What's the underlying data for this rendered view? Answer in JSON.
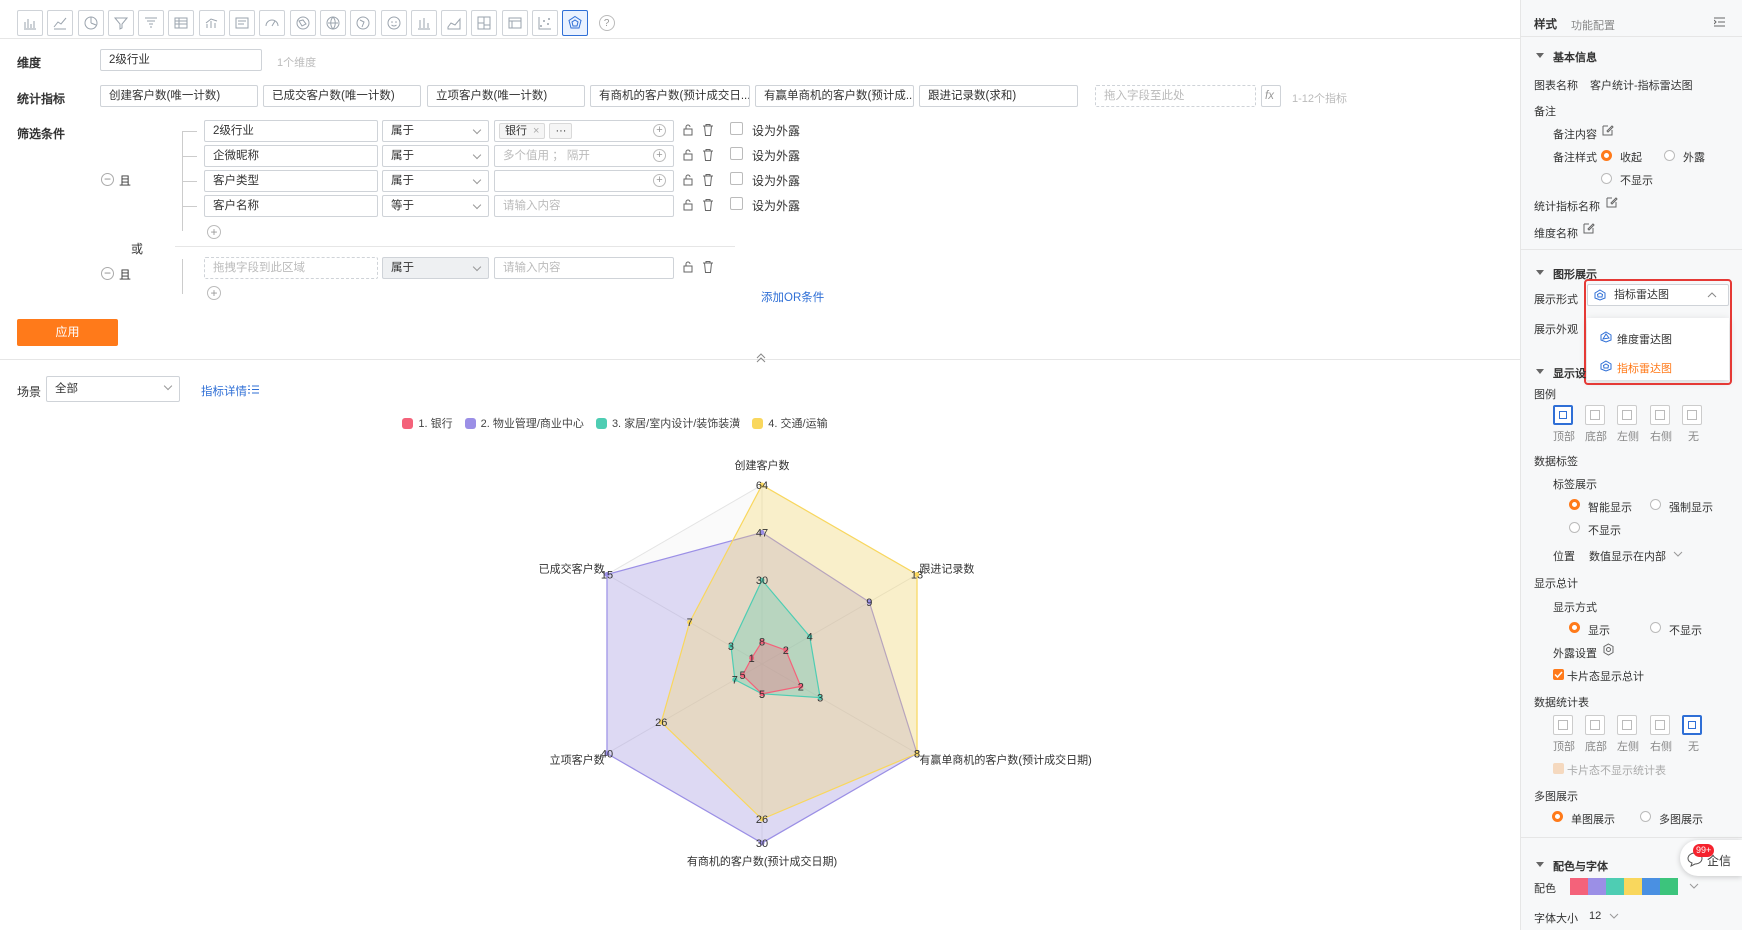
{
  "toolbar": {
    "icons": [
      "bar-chart-icon",
      "line-chart-icon",
      "pie-chart-icon",
      "funnel-icon",
      "funnel-alt-icon",
      "table-icon",
      "combo-chart-icon",
      "text-card-icon",
      "gauge-icon",
      "map-icon",
      "world-map-icon",
      "globe-icon",
      "smiley-chart-icon",
      "column-chart-icon",
      "area-chart-icon",
      "treemap-icon",
      "pivot-table-icon",
      "scatter-icon",
      "radar-chart-icon"
    ],
    "active_icon": "radar-chart-icon",
    "help": "?"
  },
  "filters": {
    "dimension_label": "维度",
    "dimension_value": "2级行业",
    "dimension_hint": "1个维度",
    "metrics_label": "统计指标",
    "metrics": [
      "创建客户数(唯一计数)",
      "已成交客户数(唯一计数)",
      "立项客户数(唯一计数)",
      "有商机的客户数(预计成交日...",
      "有赢单商机的客户数(预计成...",
      "跟进记录数(求和)"
    ],
    "metrics_drop_placeholder": "拖入字段至此处",
    "metrics_fx": "fx",
    "metrics_hint": "1-12个指标",
    "conditions_label": "筛选条件",
    "and_label": "且",
    "or_label": "或",
    "group1": [
      {
        "field": "2级行业",
        "op": "属于",
        "value_tag": "银行",
        "value_more": "···",
        "expose": "设为外露"
      },
      {
        "field": "企微昵称",
        "op": "属于",
        "value_placeholder": "多个值用 ； 隔开",
        "expose": "设为外露"
      },
      {
        "field": "客户类型",
        "op": "属于",
        "value_placeholder": "",
        "expose": "设为外露"
      },
      {
        "field": "客户名称",
        "op": "等于",
        "value_placeholder": "请输入内容",
        "expose": "设为外露"
      }
    ],
    "group2": {
      "field_placeholder": "拖拽字段到此区域",
      "op": "属于",
      "value_placeholder": "请输入内容"
    },
    "add_or": "添加OR条件",
    "apply": "应用"
  },
  "scene": {
    "label": "场景",
    "value": "全部",
    "detail_link": "指标详情"
  },
  "chart_data": {
    "type": "radar",
    "axes": [
      "创建客户数",
      "跟进记录数",
      "有赢单商机的客户数(预计成交日期)",
      "有商机的客户数(预计成交日期)",
      "立项客户数",
      "已成交客户数"
    ],
    "axis_max": [
      64,
      13,
      8,
      30,
      40,
      15
    ],
    "series": [
      {
        "name": "1. 银行",
        "color": "#f4627a",
        "values": [
          8,
          2,
          2,
          5,
          5,
          1
        ]
      },
      {
        "name": "2. 物业管理/商业中心",
        "color": "#9b8fe6",
        "values": [
          47,
          9,
          8,
          30,
          40,
          15
        ]
      },
      {
        "name": "3. 家居/室内设计/装饰装潢",
        "color": "#4ecdb3",
        "values": [
          30,
          4,
          3,
          5,
          7,
          3
        ]
      },
      {
        "name": "4. 交通/运输",
        "color": "#f9d75d",
        "values": [
          64,
          13,
          8,
          26,
          26,
          7
        ]
      }
    ]
  },
  "panel": {
    "tabs": [
      "样式",
      "功能配置"
    ],
    "basic_info": "基本信息",
    "chart_name_label": "图表名称",
    "chart_name": "客户统计-指标雷达图",
    "remark": "备注",
    "remark_content": "备注内容",
    "remark_style": "备注样式",
    "remark_opts": [
      "收起",
      "外露",
      "不显示"
    ],
    "metric_name": "统计指标名称",
    "dimension_name": "维度名称",
    "graph_display": "图形展示",
    "display_form": "展示形式",
    "display_form_value": "指标雷达图",
    "display_look": "展示外观",
    "dropdown_options": [
      "维度雷达图",
      "指标雷达图"
    ],
    "display_settings": "显示设",
    "legend": "图例",
    "legend_opts": [
      "顶部",
      "底部",
      "左侧",
      "右侧",
      "无"
    ],
    "data_label": "数据标签",
    "label_display": "标签展示",
    "label_opts": [
      "智能显示",
      "强制显示",
      "不显示"
    ],
    "position": "位置",
    "position_value": "数值显示在内部",
    "total_display": "显示总计",
    "display_mode": "显示方式",
    "display_mode_opts": [
      "显示",
      "不显示"
    ],
    "expose_settings": "外露设置",
    "card_total": "卡片态显示总计",
    "data_table": "数据统计表",
    "table_opts": [
      "顶部",
      "底部",
      "左侧",
      "右侧",
      "无"
    ],
    "card_no_table": "卡片态不显示统计表",
    "multi_chart": "多图展示",
    "multi_opts": [
      "单图展示",
      "多图展示"
    ],
    "color_font": "配色与字体",
    "palette_label": "配色",
    "palette": [
      "#f4627a",
      "#9b8fe6",
      "#4ecdb3",
      "#f9d75d",
      "#4a90e2",
      "#3cc47c"
    ],
    "font_size_label": "字体大小",
    "font_size": "12",
    "chat_badge": "99+",
    "chat_label": "企信"
  }
}
